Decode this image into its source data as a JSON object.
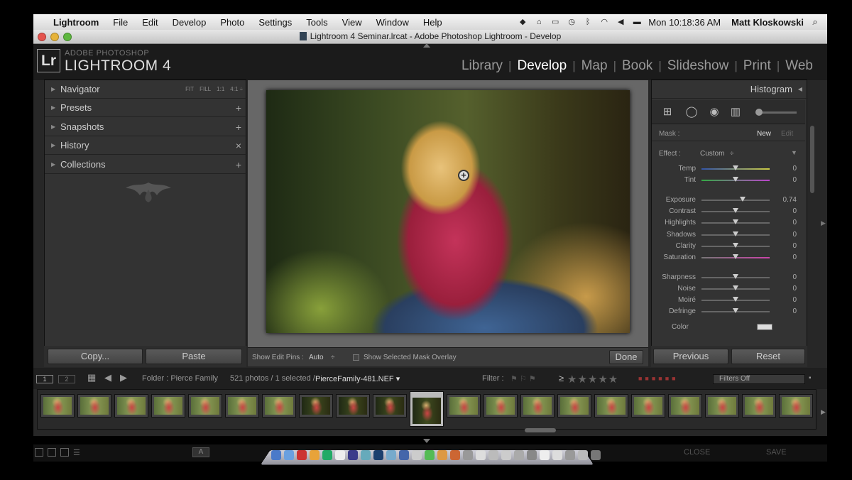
{
  "menubar": {
    "app": "Lightroom",
    "items": [
      "File",
      "Edit",
      "Develop",
      "Photo",
      "Settings",
      "Tools",
      "View",
      "Window",
      "Help"
    ],
    "clock": "Mon 10:18:36 AM",
    "user": "Matt Kloskowski"
  },
  "window": {
    "title": "Lightroom 4 Seminar.lrcat - Adobe Photoshop Lightroom - Develop"
  },
  "identity": {
    "logo": "Lr",
    "line1": "ADOBE PHOTOSHOP",
    "line2": "LIGHTROOM 4"
  },
  "modules": [
    {
      "label": "Library",
      "active": false
    },
    {
      "label": "Develop",
      "active": true
    },
    {
      "label": "Map",
      "active": false
    },
    {
      "label": "Book",
      "active": false
    },
    {
      "label": "Slideshow",
      "active": false
    },
    {
      "label": "Print",
      "active": false
    },
    {
      "label": "Web",
      "active": false
    }
  ],
  "left_panel": {
    "navigator": "Navigator",
    "nav_options": [
      "FIT",
      "FILL",
      "1:1",
      "4:1 ÷"
    ],
    "presets": "Presets",
    "snapshots": "Snapshots",
    "history": "History",
    "collections": "Collections",
    "copy_label": "Copy...",
    "paste_label": "Paste"
  },
  "toolbar": {
    "show_pins_label": "Show Edit Pins :",
    "show_pins_value": "Auto",
    "overlay_label": "Show Selected Mask Overlay",
    "done_label": "Done"
  },
  "right_panel": {
    "histogram": "Histogram",
    "mask_label": "Mask :",
    "mask_new": "New",
    "mask_edit": "Edit",
    "effect_label": "Effect :",
    "effect_value": "Custom",
    "sliders": [
      {
        "name": "Temp",
        "value": "0",
        "pos": 0.5
      },
      {
        "name": "Tint",
        "value": "0",
        "pos": 0.5
      },
      {
        "name": "Exposure",
        "value": "0.74",
        "pos": 0.6
      },
      {
        "name": "Contrast",
        "value": "0",
        "pos": 0.5
      },
      {
        "name": "Highlights",
        "value": "0",
        "pos": 0.5
      },
      {
        "name": "Shadows",
        "value": "0",
        "pos": 0.5
      },
      {
        "name": "Clarity",
        "value": "0",
        "pos": 0.5
      },
      {
        "name": "Saturation",
        "value": "0",
        "pos": 0.5
      },
      {
        "name": "Sharpness",
        "value": "0",
        "pos": 0.5
      },
      {
        "name": "Noise",
        "value": "0",
        "pos": 0.5
      },
      {
        "name": "Moiré",
        "value": "0",
        "pos": 0.5
      },
      {
        "name": "Defringe",
        "value": "0",
        "pos": 0.5
      }
    ],
    "color_label": "Color",
    "previous_label": "Previous",
    "reset_label": "Reset"
  },
  "filmstrip": {
    "monitor1": "1",
    "monitor2": "2",
    "folder": "Folder : Pierce Family",
    "count": "521 photos / 1 selected /",
    "filename": "PierceFamily-481.NEF ▾",
    "filter_label": "Filter :",
    "filters_off": "Filters Off",
    "rating_op": "≥",
    "stars": "★★★★★"
  },
  "bottom": {
    "a_label": "A",
    "close_label": "CLOSE",
    "save_label": "SAVE"
  },
  "colors": {
    "accent_active": "#ffffff",
    "panel_bg": "#333333"
  }
}
